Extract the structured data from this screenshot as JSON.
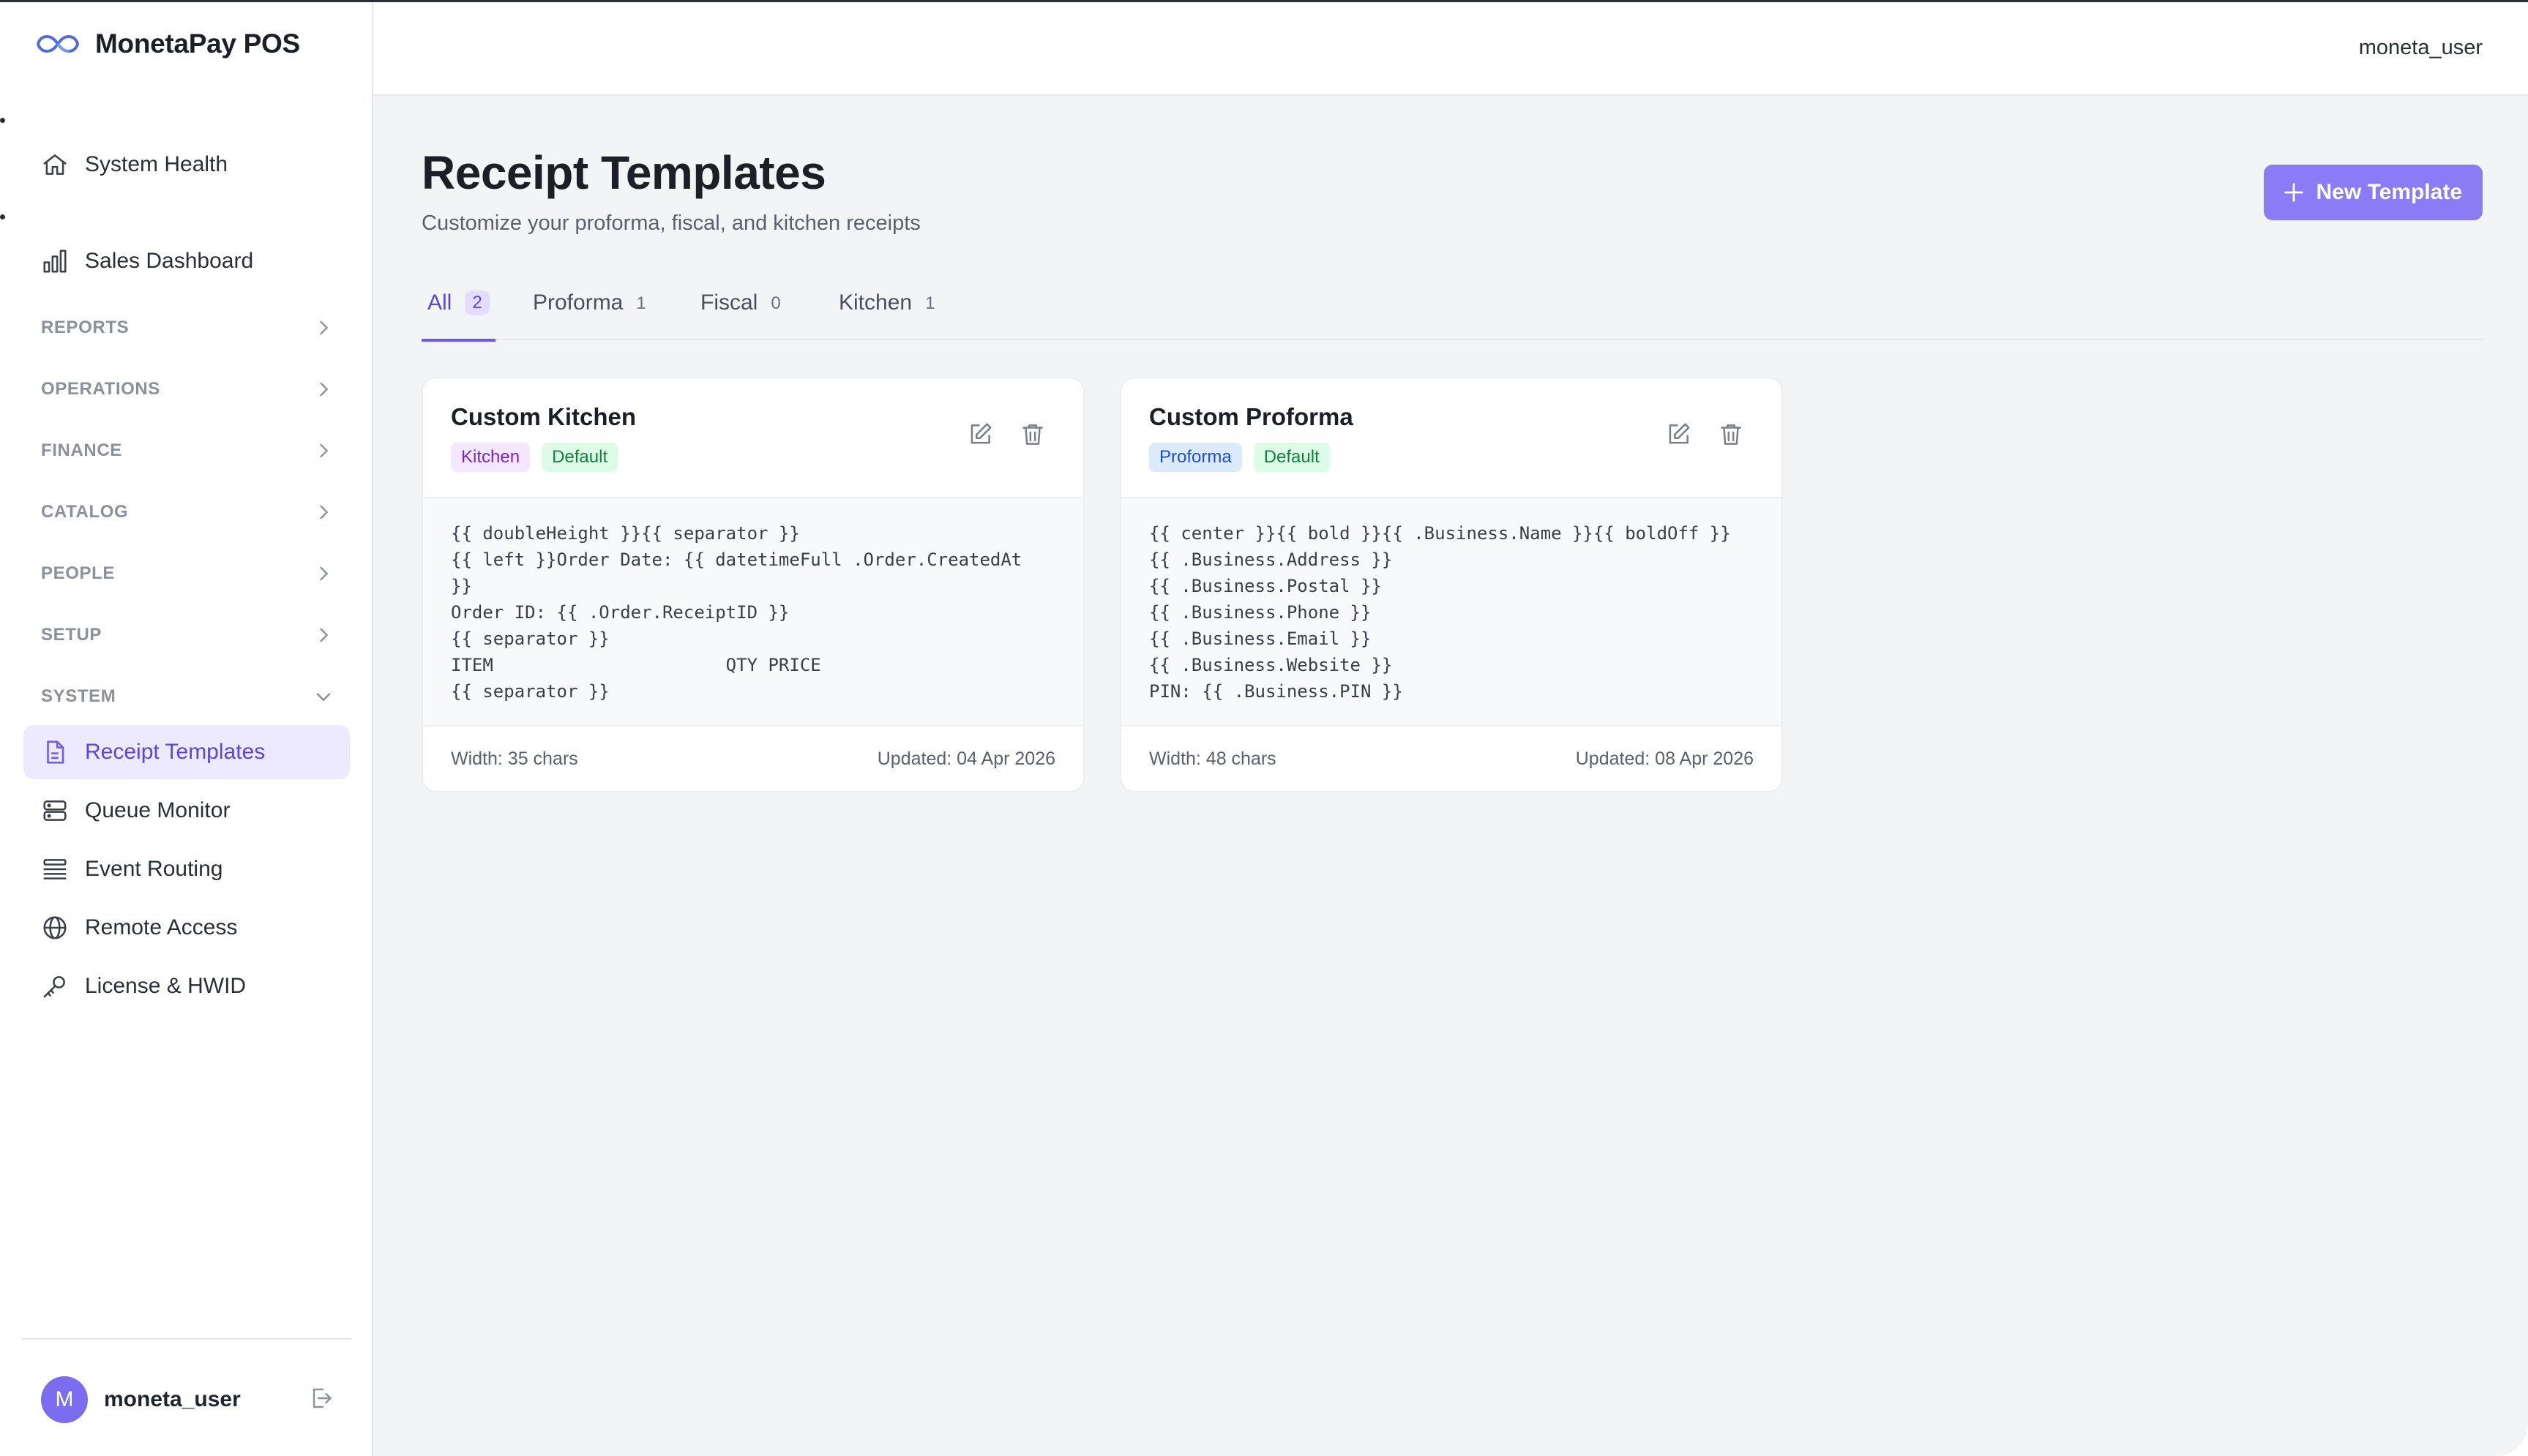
{
  "app": {
    "name": "MonetaPay POS"
  },
  "topbar": {
    "user": "moneta_user"
  },
  "sidebar": {
    "items": [
      {
        "label": "System Health",
        "icon": "home-icon"
      },
      {
        "label": "Sales Dashboard",
        "icon": "bar-chart-icon"
      }
    ],
    "groups": [
      {
        "label": "REPORTS",
        "expanded": false
      },
      {
        "label": "OPERATIONS",
        "expanded": false
      },
      {
        "label": "FINANCE",
        "expanded": false
      },
      {
        "label": "CATALOG",
        "expanded": false
      },
      {
        "label": "PEOPLE",
        "expanded": false
      },
      {
        "label": "SETUP",
        "expanded": false
      },
      {
        "label": "SYSTEM",
        "expanded": true
      }
    ],
    "system_items": [
      {
        "label": "Receipt Templates",
        "icon": "file-icon",
        "active": true
      },
      {
        "label": "Queue Monitor",
        "icon": "server-icon"
      },
      {
        "label": "Event Routing",
        "icon": "layers-icon"
      },
      {
        "label": "Remote Access",
        "icon": "globe-icon"
      },
      {
        "label": "License & HWID",
        "icon": "key-icon"
      }
    ],
    "user": {
      "initial": "M",
      "name": "moneta_user"
    }
  },
  "page": {
    "title": "Receipt Templates",
    "subtitle": "Customize your proforma, fiscal, and kitchen receipts",
    "new_button": "New Template"
  },
  "tabs": [
    {
      "label": "All",
      "count": "2",
      "active": true
    },
    {
      "label": "Proforma",
      "count": "1"
    },
    {
      "label": "Fiscal",
      "count": "0"
    },
    {
      "label": "Kitchen",
      "count": "1"
    }
  ],
  "cards": [
    {
      "title": "Custom Kitchen",
      "badges": [
        "Kitchen",
        "Default"
      ],
      "code": "{{ doubleHeight }}{{ separator }}\n{{ left }}Order Date: {{ datetimeFull .Order.CreatedAt\n}}\nOrder ID: {{ .Order.ReceiptID }}\n{{ separator }}\nITEM                      QTY PRICE\n{{ separator }}",
      "width": "Width: 35 chars",
      "updated": "Updated: 04 Apr 2026"
    },
    {
      "title": "Custom Proforma",
      "badges": [
        "Proforma",
        "Default"
      ],
      "code": "{{ center }}{{ bold }}{{ .Business.Name }}{{ boldOff }}\n{{ .Business.Address }}\n{{ .Business.Postal }}\n{{ .Business.Phone }}\n{{ .Business.Email }}\n{{ .Business.Website }}\nPIN: {{ .Business.PIN }}",
      "width": "Width: 48 chars",
      "updated": "Updated: 08 Apr 2026"
    }
  ],
  "colors": {
    "accent": "#6d5ae6",
    "button": "#8b7cf6",
    "active_nav_bg": "#ede9fe",
    "kitchen_badge": "#f3e8ff",
    "default_badge": "#dcfce7",
    "proforma_badge": "#dbeafe"
  }
}
